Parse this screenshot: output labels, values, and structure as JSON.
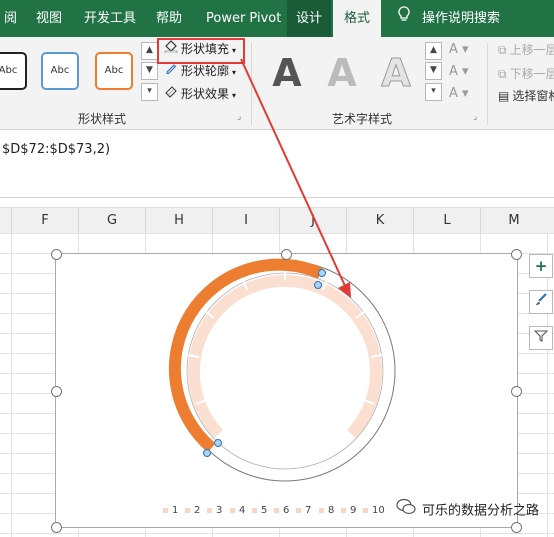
{
  "tabs": [
    {
      "label": "阅"
    },
    {
      "label": "视图"
    },
    {
      "label": "开发工具"
    },
    {
      "label": "帮助"
    },
    {
      "label": "Power Pivot"
    },
    {
      "label": "设计"
    },
    {
      "label": "格式"
    }
  ],
  "tell_me": {
    "label": "操作说明搜索"
  },
  "shape_styles": {
    "samples": [
      "Abc",
      "Abc",
      "Abc"
    ],
    "fill_label": "形状填充",
    "outline_label": "形状轮廓",
    "effects_label": "形状效果",
    "group_label": "形状样式"
  },
  "wordart": {
    "samples": [
      "A",
      "A",
      "A"
    ],
    "group_label": "艺术字样式"
  },
  "arrange": {
    "bring_forward": "上移一层",
    "send_backward": "下移一层",
    "selection_pane": "选择窗格"
  },
  "formula_bar": {
    "text": "$D$72:$D$73,2)"
  },
  "columns": [
    "F",
    "G",
    "H",
    "I",
    "J",
    "K",
    "L",
    "M"
  ],
  "legend": [
    "1",
    "2",
    "3",
    "4",
    "5",
    "6",
    "7",
    "8",
    "9",
    "10"
  ],
  "chart_side_buttons": {
    "add": "+",
    "style": "brush",
    "filter": "filter"
  },
  "watermark": {
    "text": "可乐的数据分析之路"
  },
  "colors": {
    "ribbon_green": "#217346",
    "chart_orange": "#ed7d31",
    "chart_light": "#fbe0d2",
    "highlight_red": "#e53935"
  }
}
